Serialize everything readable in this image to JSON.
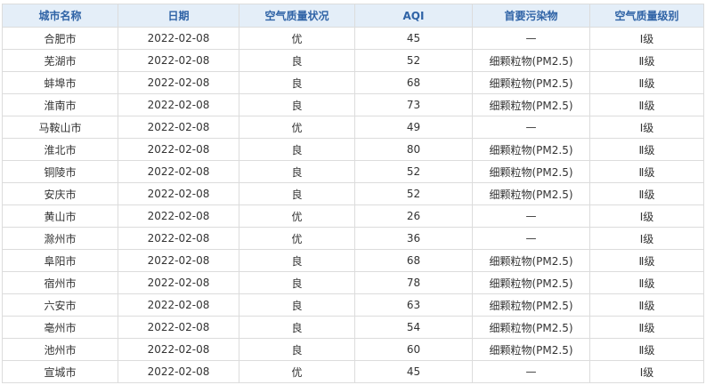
{
  "columns": [
    "城市名称",
    "日期",
    "空气质量状况",
    "AQI",
    "首要污染物",
    "空气质量级别"
  ],
  "rows": [
    {
      "city": "合肥市",
      "date": "2022-02-08",
      "status": "优",
      "aqi": "45",
      "pollutant": "—",
      "level": "Ⅰ级"
    },
    {
      "city": "芜湖市",
      "date": "2022-02-08",
      "status": "良",
      "aqi": "52",
      "pollutant": "细颗粒物(PM2.5)",
      "level": "Ⅱ级"
    },
    {
      "city": "蚌埠市",
      "date": "2022-02-08",
      "status": "良",
      "aqi": "68",
      "pollutant": "细颗粒物(PM2.5)",
      "level": "Ⅱ级"
    },
    {
      "city": "淮南市",
      "date": "2022-02-08",
      "status": "良",
      "aqi": "73",
      "pollutant": "细颗粒物(PM2.5)",
      "level": "Ⅱ级"
    },
    {
      "city": "马鞍山市",
      "date": "2022-02-08",
      "status": "优",
      "aqi": "49",
      "pollutant": "—",
      "level": "Ⅰ级"
    },
    {
      "city": "淮北市",
      "date": "2022-02-08",
      "status": "良",
      "aqi": "80",
      "pollutant": "细颗粒物(PM2.5)",
      "level": "Ⅱ级"
    },
    {
      "city": "铜陵市",
      "date": "2022-02-08",
      "status": "良",
      "aqi": "52",
      "pollutant": "细颗粒物(PM2.5)",
      "level": "Ⅱ级"
    },
    {
      "city": "安庆市",
      "date": "2022-02-08",
      "status": "良",
      "aqi": "52",
      "pollutant": "细颗粒物(PM2.5)",
      "level": "Ⅱ级"
    },
    {
      "city": "黄山市",
      "date": "2022-02-08",
      "status": "优",
      "aqi": "26",
      "pollutant": "—",
      "level": "Ⅰ级"
    },
    {
      "city": "滁州市",
      "date": "2022-02-08",
      "status": "优",
      "aqi": "36",
      "pollutant": "—",
      "level": "Ⅰ级"
    },
    {
      "city": "阜阳市",
      "date": "2022-02-08",
      "status": "良",
      "aqi": "68",
      "pollutant": "细颗粒物(PM2.5)",
      "level": "Ⅱ级"
    },
    {
      "city": "宿州市",
      "date": "2022-02-08",
      "status": "良",
      "aqi": "78",
      "pollutant": "细颗粒物(PM2.5)",
      "level": "Ⅱ级"
    },
    {
      "city": "六安市",
      "date": "2022-02-08",
      "status": "良",
      "aqi": "63",
      "pollutant": "细颗粒物(PM2.5)",
      "level": "Ⅱ级"
    },
    {
      "city": "亳州市",
      "date": "2022-02-08",
      "status": "良",
      "aqi": "54",
      "pollutant": "细颗粒物(PM2.5)",
      "level": "Ⅱ级"
    },
    {
      "city": "池州市",
      "date": "2022-02-08",
      "status": "良",
      "aqi": "60",
      "pollutant": "细颗粒物(PM2.5)",
      "level": "Ⅱ级"
    },
    {
      "city": "宣城市",
      "date": "2022-02-08",
      "status": "优",
      "aqi": "45",
      "pollutant": "—",
      "level": "Ⅰ级"
    }
  ]
}
